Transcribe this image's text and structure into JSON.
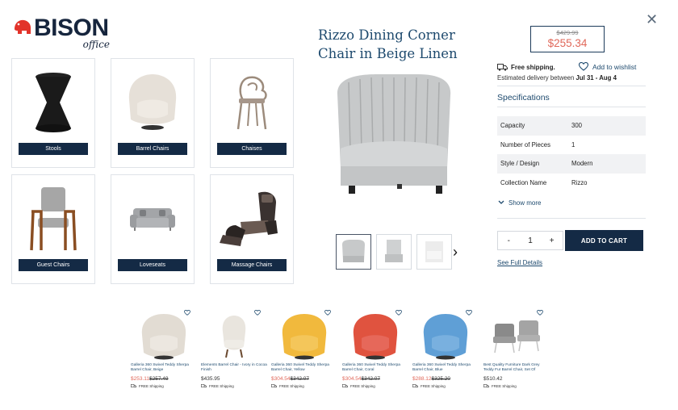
{
  "brand": {
    "name": "BISON",
    "sub": "office"
  },
  "close_label": "✕",
  "categories": [
    {
      "label": "Stools",
      "icon": "stool-icon"
    },
    {
      "label": "Barrel Chairs",
      "icon": "barrel-chair-icon"
    },
    {
      "label": "Chaises",
      "icon": "chaise-icon"
    },
    {
      "label": "Guest Chairs",
      "icon": "guest-chair-icon"
    },
    {
      "label": "Loveseats",
      "icon": "loveseat-icon"
    },
    {
      "label": "Massage Chairs",
      "icon": "massage-chair-icon"
    }
  ],
  "product": {
    "title": "Rizzo Dining Corner Chair in Beige Linen",
    "old_price": "$429.99",
    "price": "$255.34",
    "free_shipping": "Free shipping.",
    "wishlist": "Add to wishlist",
    "delivery_prefix": "Estimated delivery between",
    "delivery_range": "Jul 31 - Aug 4",
    "specs_title": "Specifications",
    "specs": [
      {
        "key": "Capacity",
        "value": "300"
      },
      {
        "key": "Number of Pieces",
        "value": "1"
      },
      {
        "key": "Style / Design",
        "value": "Modern"
      },
      {
        "key": "Collection Name",
        "value": "Rizzo"
      }
    ],
    "show_more": "Show more",
    "qty_minus": "-",
    "qty_value": "1",
    "qty_plus": "+",
    "add_to_cart": "ADD TO CART",
    "full_details": "See Full Details",
    "next_arrow": "›"
  },
  "recommendations": [
    {
      "name": "Galleria 360 Swivel Teddy Sherpa Barrel Chair, Beige",
      "sale": "$253.11",
      "was": "$257.49",
      "ship": "FREE Shipping",
      "color": "#e2dcd3"
    },
    {
      "name": "Elements Barrel Chair - Ivory in Cocoa Finish",
      "sale": "",
      "reg": "$435.95",
      "was": "",
      "ship": "FREE Shipping",
      "color": "#e9e5de"
    },
    {
      "name": "Galleria 360 Swivel Teddy Sherpa Barrel Chair, Yellow",
      "sale": "$304.54",
      "was": "$342.07",
      "ship": "FREE Shipping",
      "color": "#f1b93d"
    },
    {
      "name": "Galleria 360 Swivel Teddy Sherpa Barrel Chair, Coral",
      "sale": "$304.54",
      "was": "$342.07",
      "ship": "FREE Shipping",
      "color": "#e0533f"
    },
    {
      "name": "Galleria 360 Swivel Teddy Sherpa Barrel Chair, Blue",
      "sale": "$288.12",
      "was": "$325.20",
      "ship": "FREE Shipping",
      "color": "#5f9fd6"
    },
    {
      "name": "Best Quality Furniture Dark Grey Teddy Fur Barrel Chair, Set Of",
      "sale": "",
      "reg": "$510.42",
      "was": "",
      "ship": "FREE Shipping",
      "color": "#8a8a8a"
    }
  ],
  "colors": {
    "navy": "#142a45",
    "accent": "#1e4a6e",
    "sale": "#e0685a"
  }
}
